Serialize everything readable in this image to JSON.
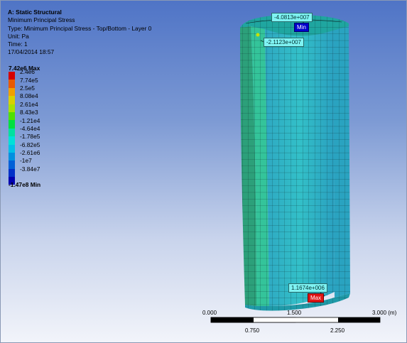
{
  "info": {
    "title": "A: Static Structural",
    "line1": "Minimum Principal Stress",
    "line2": "Type: Minimum Principal Stress - Top/Bottom - Layer 0",
    "line3": "Unit: Pa",
    "line4": "Time: 1",
    "line5": "17/04/2014 18:57"
  },
  "legend": {
    "max_label": "7.42e6 Max",
    "min_label": "-1.47e8 Min",
    "entries": [
      {
        "label": "2.4e6",
        "color": "#d40000"
      },
      {
        "label": "7.74e5",
        "color": "#e85a00"
      },
      {
        "label": "2.5e5",
        "color": "#f0a000"
      },
      {
        "label": "8.08e4",
        "color": "#d8d000"
      },
      {
        "label": "2.61e4",
        "color": "#a8e000"
      },
      {
        "label": "8.43e3",
        "color": "#50e000"
      },
      {
        "label": "-1.21e4",
        "color": "#00e040"
      },
      {
        "label": "-4.64e4",
        "color": "#00e0a0"
      },
      {
        "label": "-1.78e5",
        "color": "#00e0d8"
      },
      {
        "label": "-6.82e5",
        "color": "#00c0e8"
      },
      {
        "label": "-2.61e6",
        "color": "#0090e0"
      },
      {
        "label": "-1e7",
        "color": "#0060d8"
      },
      {
        "label": "-3.84e7",
        "color": "#0030c8"
      },
      {
        "label": "",
        "color": "#0000b0"
      }
    ]
  },
  "probes": {
    "top_value": "-4.0813e+007",
    "min_tag": "Min",
    "mid_value": "-2.1123e+007",
    "bottom_value": "1.1674e+006",
    "max_tag": "Max"
  },
  "scale": {
    "l0": "0.000",
    "l1": "1.500",
    "l2": "3.000 (m)",
    "l3": "0.750",
    "l4": "2.250"
  }
}
